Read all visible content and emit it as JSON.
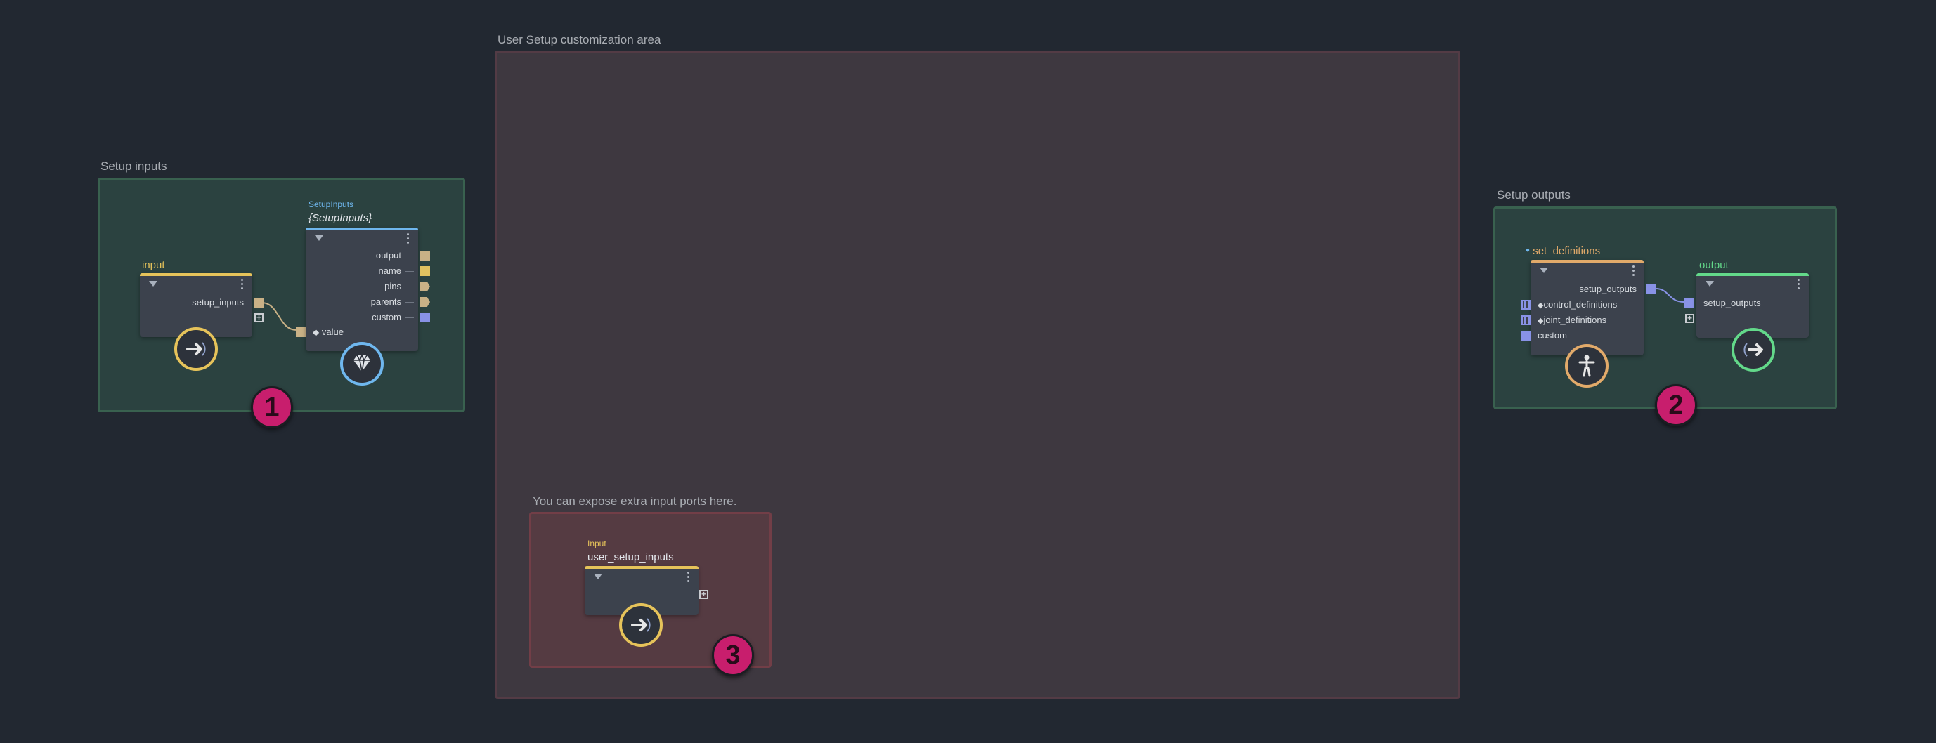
{
  "groups": {
    "setup_inputs": {
      "title": "Setup inputs"
    },
    "customization": {
      "title": "User Setup customization area"
    },
    "extra_ports": {
      "title": "You can expose extra input ports here."
    },
    "setup_outputs": {
      "title": "Setup outputs"
    }
  },
  "nodes": {
    "input": {
      "title": "input",
      "ports": {
        "setup_inputs": "setup_inputs"
      }
    },
    "setup_inputs": {
      "type": "SetupInputs",
      "name": "{SetupInputs}",
      "ports": {
        "output": "output",
        "name": "name",
        "pins": "pins",
        "parents": "parents",
        "custom": "custom",
        "value": "value"
      }
    },
    "user_setup_inputs": {
      "type": "Input",
      "name": "user_setup_inputs"
    },
    "set_definitions": {
      "title": "set_definitions",
      "ports": {
        "setup_outputs": "setup_outputs",
        "control_definitions": "control_definitions",
        "joint_definitions": "joint_definitions",
        "custom": "custom"
      }
    },
    "output": {
      "title": "output",
      "ports": {
        "setup_outputs": "setup_outputs"
      }
    }
  },
  "badges": {
    "one": "1",
    "two": "2",
    "three": "3"
  },
  "colors": {
    "background": "#222831",
    "input_accent": "#e6c35a",
    "setup_inputs_accent": "#6fb7ee",
    "set_definitions_accent": "#e2aa6a",
    "output_accent": "#63d98a",
    "badge": "#c81e6d"
  },
  "icons": {
    "input_node": "arrow-right-icon",
    "setup_inputs_node": "diamond-gem-icon",
    "set_definitions_node": "skeleton-figure-icon",
    "output_node": "arrow-right-icon"
  }
}
